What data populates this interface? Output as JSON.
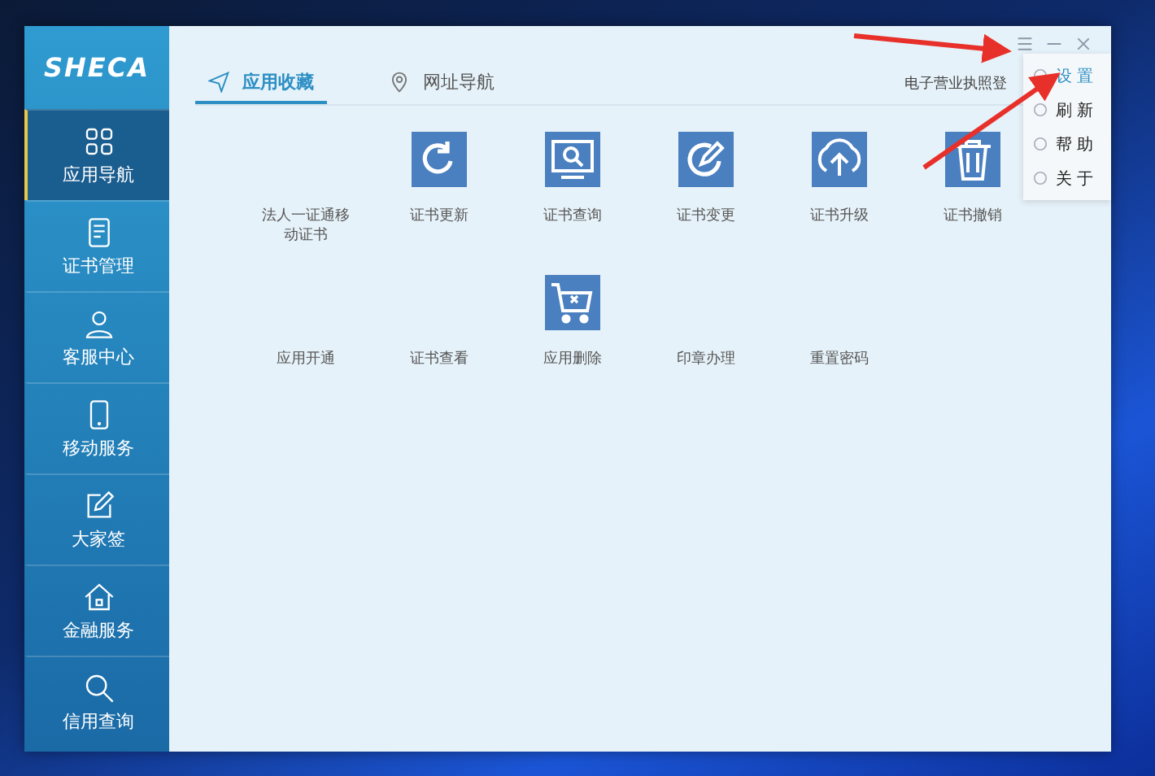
{
  "logo_text": "SHECA",
  "sidebar": {
    "items": [
      {
        "label": "应用导航",
        "kind": "grid",
        "selected": true
      },
      {
        "label": "证书管理",
        "kind": "doc",
        "selected": false
      },
      {
        "label": "客服中心",
        "kind": "person",
        "selected": false
      },
      {
        "label": "移动服务",
        "kind": "phone",
        "selected": false
      },
      {
        "label": "大家签",
        "kind": "sign",
        "selected": false
      },
      {
        "label": "金融服务",
        "kind": "home",
        "selected": false
      },
      {
        "label": "信用查询",
        "kind": "search",
        "selected": false
      }
    ]
  },
  "tabs": [
    {
      "label": "应用收藏",
      "kind": "send",
      "selected": true
    },
    {
      "label": "网址导航",
      "kind": "pin",
      "selected": false
    }
  ],
  "header_text": "电子营业执照登",
  "menu": {
    "items": [
      {
        "label": "设 置",
        "selected": true
      },
      {
        "label": "刷 新",
        "selected": false
      },
      {
        "label": "帮 助",
        "selected": false
      },
      {
        "label": "关 于",
        "selected": false
      }
    ]
  },
  "apps": [
    [
      {
        "label": "法人一证通移动证书",
        "kind": "plain"
      },
      {
        "label": "证书更新",
        "kind": "refresh"
      },
      {
        "label": "证书查询",
        "kind": "query"
      },
      {
        "label": "证书变更",
        "kind": "edit"
      },
      {
        "label": "证书升级",
        "kind": "upload"
      },
      {
        "label": "证书撤销",
        "kind": "trash"
      }
    ],
    [
      {
        "label": "应用开通",
        "kind": "plain"
      },
      {
        "label": "证书查看",
        "kind": "plain"
      },
      {
        "label": "应用删除",
        "kind": "cart"
      },
      {
        "label": "印章办理",
        "kind": "plain"
      },
      {
        "label": "重置密码",
        "kind": "plain"
      }
    ]
  ]
}
